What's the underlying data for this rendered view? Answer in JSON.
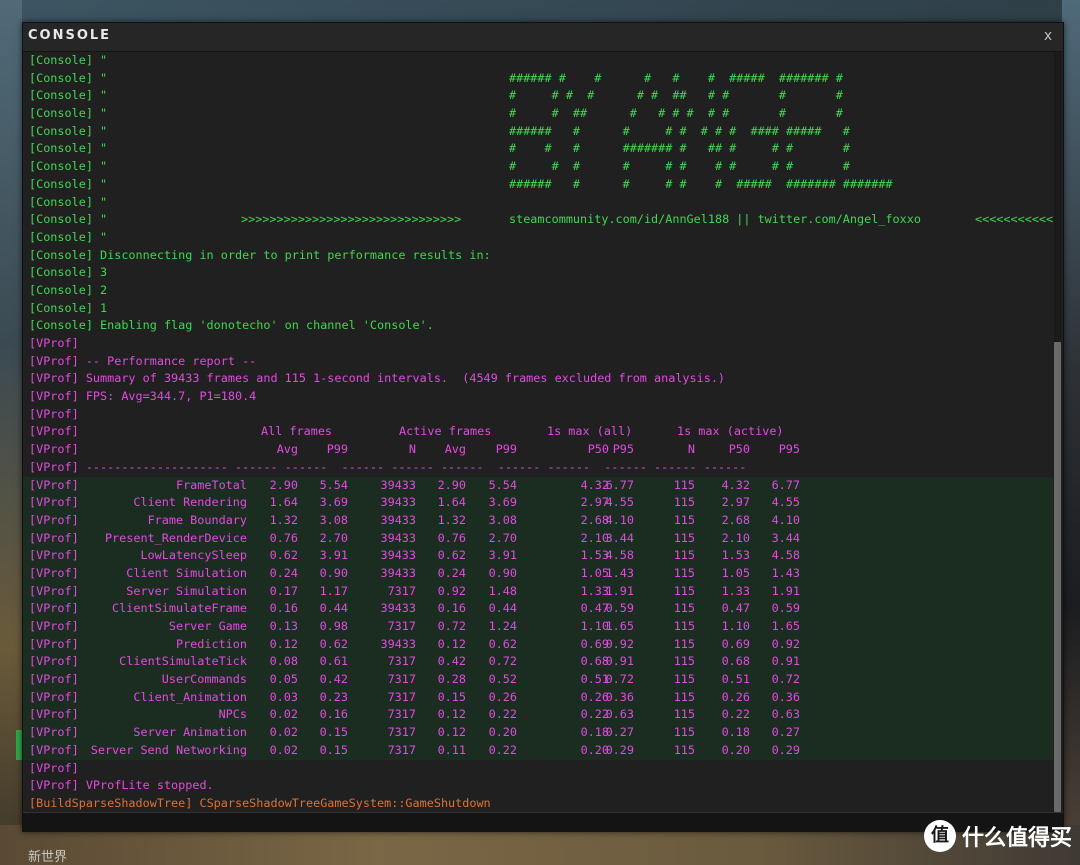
{
  "window": {
    "title": "CONSOLE",
    "close_label": "x"
  },
  "console_lines": [
    {
      "prefix": "[Console]",
      "text": " \"",
      "color": "green"
    },
    {
      "prefix": "[Console]",
      "text": " \"",
      "art": "###### #    #      #   #    #  #####  ####### #",
      "color": "green"
    },
    {
      "prefix": "[Console]",
      "text": " \"",
      "art": "#     # #  #      # #  ##   # #       #       #",
      "color": "green"
    },
    {
      "prefix": "[Console]",
      "text": " \"",
      "art": "#     #  ##      #   # # #  # #       #       #",
      "color": "green"
    },
    {
      "prefix": "[Console]",
      "text": " \"",
      "art": "######   #      #     # #  # # #  #### #####   #",
      "color": "green"
    },
    {
      "prefix": "[Console]",
      "text": " \"",
      "art": "#    #   #      ####### #   ## #     # #       #",
      "color": "green"
    },
    {
      "prefix": "[Console]",
      "text": " \"",
      "art": "#     #  #      #     # #    # #     # #       #",
      "color": "green"
    },
    {
      "prefix": "[Console]",
      "text": " \"",
      "art": "######   #      #     # #    #  #####  ####### #######",
      "color": "green"
    },
    {
      "prefix": "[Console]",
      "text": " \"",
      "color": "green"
    },
    {
      "prefix": "[Console]",
      "text": " \"",
      "arrows_left": ">>>>>>>>>>>>>>>>>>>>>>>>>>>>>>>",
      "links": "steamcommunity.com/id/AnnGel188 || twitter.com/Angel_foxxo",
      "arrows_right": "<<<<<<<<<<<<<<<<<<<",
      "color": "green"
    },
    {
      "prefix": "[Console]",
      "text": " \"",
      "color": "green"
    },
    {
      "prefix": "[Console]",
      "text": " Disconnecting in order to print performance results in:",
      "color": "green"
    },
    {
      "prefix": "[Console]",
      "text": " 3",
      "color": "green"
    },
    {
      "prefix": "[Console]",
      "text": " 2",
      "color": "green"
    },
    {
      "prefix": "[Console]",
      "text": " 1",
      "color": "green"
    },
    {
      "prefix": "[Console]",
      "text": " Enabling flag 'donotecho' on channel 'Console'.",
      "color": "green"
    },
    {
      "prefix": "[VProf]",
      "text": "",
      "color": "magenta"
    },
    {
      "prefix": "[VProf]",
      "text": " -- Performance report --",
      "color": "magenta"
    },
    {
      "prefix": "[VProf]",
      "text": " Summary of 39433 frames and 115 1-second intervals.  (4549 frames excluded from analysis.)",
      "color": "magenta"
    },
    {
      "prefix": "[VProf]",
      "text": " FPS: Avg=344.7, P1=180.4",
      "color": "magenta"
    },
    {
      "prefix": "[VProf]",
      "text": "",
      "color": "magenta"
    }
  ],
  "vprof_table": {
    "prefix": "[VProf]",
    "group_headers": [
      "All frames",
      "Active frames",
      "1s max (all)",
      "1s max (active)"
    ],
    "col_headers": [
      "Avg",
      "P99",
      "N",
      "Avg",
      "P99",
      "P50",
      "P95",
      "N",
      "P50",
      "P95"
    ],
    "separator": "[VProf] -------------------- ------ ------  ------ ------ ------  ------ ------  ------ ------ ------",
    "rows": [
      {
        "name": "FrameTotal",
        "v": [
          "2.90",
          "5.54",
          "39433",
          "2.90",
          "5.54",
          "4.32",
          "6.77",
          "115",
          "4.32",
          "6.77"
        ]
      },
      {
        "name": "Client Rendering",
        "v": [
          "1.64",
          "3.69",
          "39433",
          "1.64",
          "3.69",
          "2.97",
          "4.55",
          "115",
          "2.97",
          "4.55"
        ]
      },
      {
        "name": "Frame Boundary",
        "v": [
          "1.32",
          "3.08",
          "39433",
          "1.32",
          "3.08",
          "2.68",
          "4.10",
          "115",
          "2.68",
          "4.10"
        ]
      },
      {
        "name": "Present_RenderDevice",
        "v": [
          "0.76",
          "2.70",
          "39433",
          "0.76",
          "2.70",
          "2.10",
          "3.44",
          "115",
          "2.10",
          "3.44"
        ]
      },
      {
        "name": "LowLatencySleep",
        "v": [
          "0.62",
          "3.91",
          "39433",
          "0.62",
          "3.91",
          "1.53",
          "4.58",
          "115",
          "1.53",
          "4.58"
        ]
      },
      {
        "name": "Client Simulation",
        "v": [
          "0.24",
          "0.90",
          "39433",
          "0.24",
          "0.90",
          "1.05",
          "1.43",
          "115",
          "1.05",
          "1.43"
        ]
      },
      {
        "name": "Server Simulation",
        "v": [
          "0.17",
          "1.17",
          "7317",
          "0.92",
          "1.48",
          "1.33",
          "1.91",
          "115",
          "1.33",
          "1.91"
        ]
      },
      {
        "name": "ClientSimulateFrame",
        "v": [
          "0.16",
          "0.44",
          "39433",
          "0.16",
          "0.44",
          "0.47",
          "0.59",
          "115",
          "0.47",
          "0.59"
        ]
      },
      {
        "name": "Server Game",
        "v": [
          "0.13",
          "0.98",
          "7317",
          "0.72",
          "1.24",
          "1.10",
          "1.65",
          "115",
          "1.10",
          "1.65"
        ]
      },
      {
        "name": "Prediction",
        "v": [
          "0.12",
          "0.62",
          "39433",
          "0.12",
          "0.62",
          "0.69",
          "0.92",
          "115",
          "0.69",
          "0.92"
        ]
      },
      {
        "name": "ClientSimulateTick",
        "v": [
          "0.08",
          "0.61",
          "7317",
          "0.42",
          "0.72",
          "0.68",
          "0.91",
          "115",
          "0.68",
          "0.91"
        ]
      },
      {
        "name": "UserCommands",
        "v": [
          "0.05",
          "0.42",
          "7317",
          "0.28",
          "0.52",
          "0.51",
          "0.72",
          "115",
          "0.51",
          "0.72"
        ]
      },
      {
        "name": "Client_Animation",
        "v": [
          "0.03",
          "0.23",
          "7317",
          "0.15",
          "0.26",
          "0.26",
          "0.36",
          "115",
          "0.26",
          "0.36"
        ]
      },
      {
        "name": "NPCs",
        "v": [
          "0.02",
          "0.16",
          "7317",
          "0.12",
          "0.22",
          "0.22",
          "0.63",
          "115",
          "0.22",
          "0.63"
        ]
      },
      {
        "name": "Server Animation",
        "v": [
          "0.02",
          "0.15",
          "7317",
          "0.12",
          "0.20",
          "0.18",
          "0.27",
          "115",
          "0.18",
          "0.27"
        ]
      },
      {
        "name": "Server Send Networking",
        "v": [
          "0.02",
          "0.15",
          "7317",
          "0.11",
          "0.22",
          "0.20",
          "0.29",
          "115",
          "0.20",
          "0.29"
        ]
      }
    ]
  },
  "tail_lines": [
    {
      "prefix": "[VProf]",
      "text": "",
      "color": "magenta"
    },
    {
      "prefix": "[VProf]",
      "text": " VProfLite stopped.",
      "color": "magenta"
    },
    {
      "prefix": "[BuildSparseShadowTree]",
      "text": " CSparseShadowTreeGameSystem::GameShutdown",
      "color": "orange"
    }
  ],
  "background": {
    "bottom_left_text": "新世界"
  },
  "watermark": {
    "logo": "值",
    "text": "什么值得买"
  },
  "colors": {
    "console": "#41d653",
    "vprof": "#e14be0",
    "shadow": "#e0722e",
    "window_bg": "#202020"
  }
}
